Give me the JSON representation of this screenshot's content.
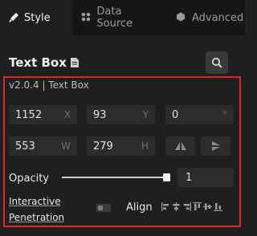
{
  "tabs": [
    {
      "label": "Style",
      "icon": "brush-icon",
      "active": true
    },
    {
      "label": "Data Source",
      "icon": "grid-icon",
      "active": false
    },
    {
      "label": "Advanced",
      "icon": "hexagon-icon",
      "active": false
    }
  ],
  "component": {
    "title": "Text Box",
    "version": "v2.0.4 | Text Box"
  },
  "position": {
    "x": {
      "value": "1152",
      "unit": "X"
    },
    "y": {
      "value": "93",
      "unit": "Y"
    },
    "rotation": {
      "value": "0",
      "unit": "°"
    }
  },
  "size": {
    "w": {
      "value": "553",
      "unit": "W"
    },
    "h": {
      "value": "279",
      "unit": "H"
    }
  },
  "opacity": {
    "label": "Opacity",
    "value": "1",
    "level": 1
  },
  "interactive": {
    "label_line1": "Interactive",
    "label_line2": "Penetration",
    "enabled": false
  },
  "align": {
    "label": "Align",
    "icons": [
      "align-left-icon",
      "align-center-h-icon",
      "align-right-icon",
      "align-top-icon",
      "align-middle-v-icon",
      "align-bottom-icon"
    ]
  },
  "colors": {
    "highlight_border": "#e0262b",
    "background": "#1f1f1f"
  }
}
